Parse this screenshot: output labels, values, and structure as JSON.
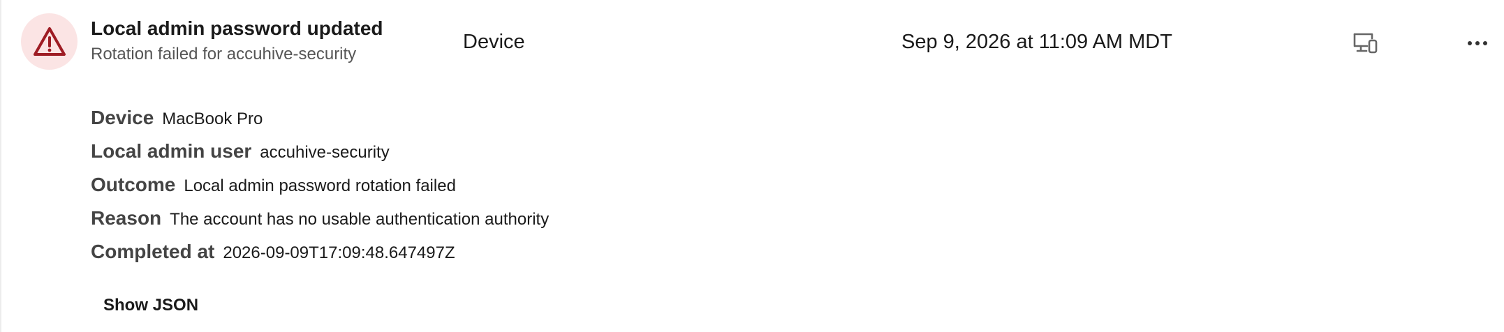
{
  "event": {
    "title": "Local admin password updated",
    "subtitle": "Rotation failed for accuhive-security",
    "category": "Device",
    "timestamp": "Sep 9, 2026 at 11:09 AM MDT",
    "status_icon": "warning-triangle-icon",
    "status_color": "#9e1c24",
    "status_background": "#fbe4e4"
  },
  "actions": {
    "device_icon": "devices-icon",
    "more_icon": "more-horizontal-icon"
  },
  "details": [
    {
      "label": "Device",
      "value": "MacBook Pro"
    },
    {
      "label": "Local admin user",
      "value": "accuhive-security"
    },
    {
      "label": "Outcome",
      "value": "Local admin password rotation failed"
    },
    {
      "label": "Reason",
      "value": "The account has no usable authentication authority"
    },
    {
      "label": "Completed at",
      "value": "2026-09-09T17:09:48.647497Z"
    }
  ],
  "show_json_label": "Show JSON"
}
